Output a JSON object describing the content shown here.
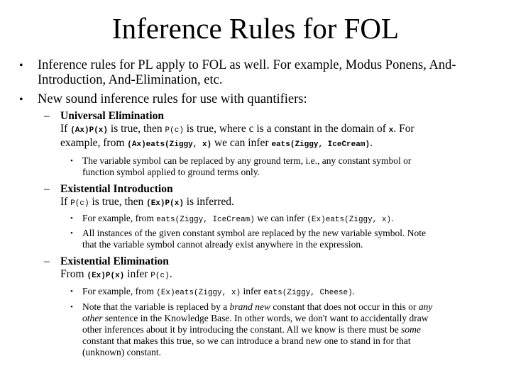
{
  "title": "Inference Rules for FOL",
  "bullets": [
    {
      "text": "Inference rules for PL apply to FOL as well. For example, Modus Ponens, And-Introduction, And-Elimination, etc.",
      "line1": "Inference rules for PL apply to FOL as well. For example, Modus Ponens, And-",
      "line2": "Introduction, And-Elimination, etc."
    },
    {
      "text": "New sound inference rules for use with quantifiers:"
    }
  ],
  "rules": [
    {
      "heading": "Universal Elimination",
      "body": {
        "p1": "If ",
        "c1": "(Ax)P(x)",
        "p2": " is true, then ",
        "c2": "P(c)",
        "p3": " is true, where c is a constant in the domain of ",
        "c3": "x",
        "p4": ". For",
        "p5": "example, from ",
        "c4": "(Ax)eats(Ziggy, x)",
        "p6": " we can infer ",
        "c5": "eats(Ziggy, IceCream)",
        "p7": "."
      },
      "notes": [
        {
          "line1": "The variable symbol can be replaced by any ground term, i.e., any constant symbol or",
          "line2": "function symbol applied to ground terms only."
        }
      ]
    },
    {
      "heading": "Existential Introduction",
      "body": {
        "p1": "If ",
        "c1": "P(c)",
        "p2": " is true, then ",
        "c2": "(Ex)P(x)",
        "p3": " is inferred."
      },
      "notes": [
        {
          "p1": "For example, from ",
          "c1": "eats(Ziggy, IceCream)",
          "p2": " we can infer ",
          "c2": "(Ex)eats(Ziggy, x)",
          "p3": "."
        },
        {
          "line1": "All instances of the given constant symbol are replaced by the new variable symbol. Note",
          "line2": "that the variable symbol cannot already exist anywhere in the expression."
        }
      ]
    },
    {
      "heading": "Existential Elimination",
      "body": {
        "p1": "From ",
        "c1": "(Ex)P(x)",
        "p2": " infer ",
        "c2": "P(c)",
        "p3": "."
      },
      "notes": [
        {
          "p1": "For example, from ",
          "c1": "(Ex)eats(Ziggy, x)",
          "p2": " infer ",
          "c2": "eats(Ziggy, Cheese)",
          "p3": "."
        },
        {
          "a": "Note that the variable is replaced by a ",
          "i1": "brand new",
          "b": " constant that does not occur in this or ",
          "i2": "any",
          "c": "other",
          "d": " sentence in the Knowledge Base. In other words, we don't want to accidentally draw",
          "e": "other inferences about it by introducing the constant. All we know is there must be ",
          "i3": "some",
          "f": "constant that makes this true, so we can introduce a brand new one to stand in for that",
          "g": "(unknown) constant."
        }
      ]
    }
  ],
  "symbols": {
    "bullet": "•",
    "dash": "–",
    "dot": "•"
  }
}
